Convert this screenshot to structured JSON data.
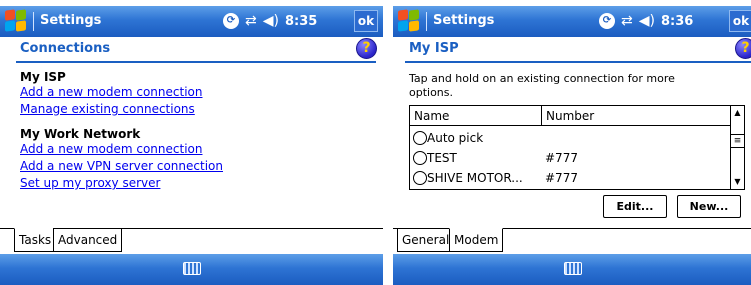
{
  "left": {
    "titlebar": {
      "title": "Settings",
      "time": "8:35",
      "ok": "ok"
    },
    "header": {
      "title": "Connections",
      "help": "?"
    },
    "groups": [
      {
        "title": "My ISP",
        "links": [
          "Add a new modem connection",
          "Manage existing connections"
        ]
      },
      {
        "title": "My Work Network",
        "links": [
          "Add a new modem connection",
          "Add a new VPN server connection",
          "Set up my proxy server"
        ]
      }
    ],
    "tabs": [
      "Tasks",
      "Advanced"
    ],
    "active_tab": "Tasks"
  },
  "right": {
    "titlebar": {
      "title": "Settings",
      "time": "8:36",
      "ok": "ok"
    },
    "header": {
      "title": "My ISP",
      "help": "?"
    },
    "instruction": "Tap and hold on an existing connection for more options.",
    "table": {
      "columns": [
        "Name",
        "Number"
      ],
      "rows": [
        {
          "name": "Auto pick",
          "number": ""
        },
        {
          "name": "TEST",
          "number": "#777"
        },
        {
          "name": "SHIVE MOTOR...",
          "number": "#777"
        }
      ]
    },
    "buttons": {
      "edit": "Edit...",
      "new": "New..."
    },
    "tabs": [
      "General",
      "Modem"
    ],
    "active_tab": "Modem"
  },
  "icons": {
    "start": "windows-flag-icon",
    "sync": "activesync-icon",
    "connectivity": "connectivity-arrows-icon",
    "volume": "speaker-icon",
    "keyboard": "keyboard-icon",
    "help": "help-icon"
  },
  "colors": {
    "titlebar": "#2e74d4",
    "header_text": "#1a5fc2",
    "link": "#0000ee"
  }
}
